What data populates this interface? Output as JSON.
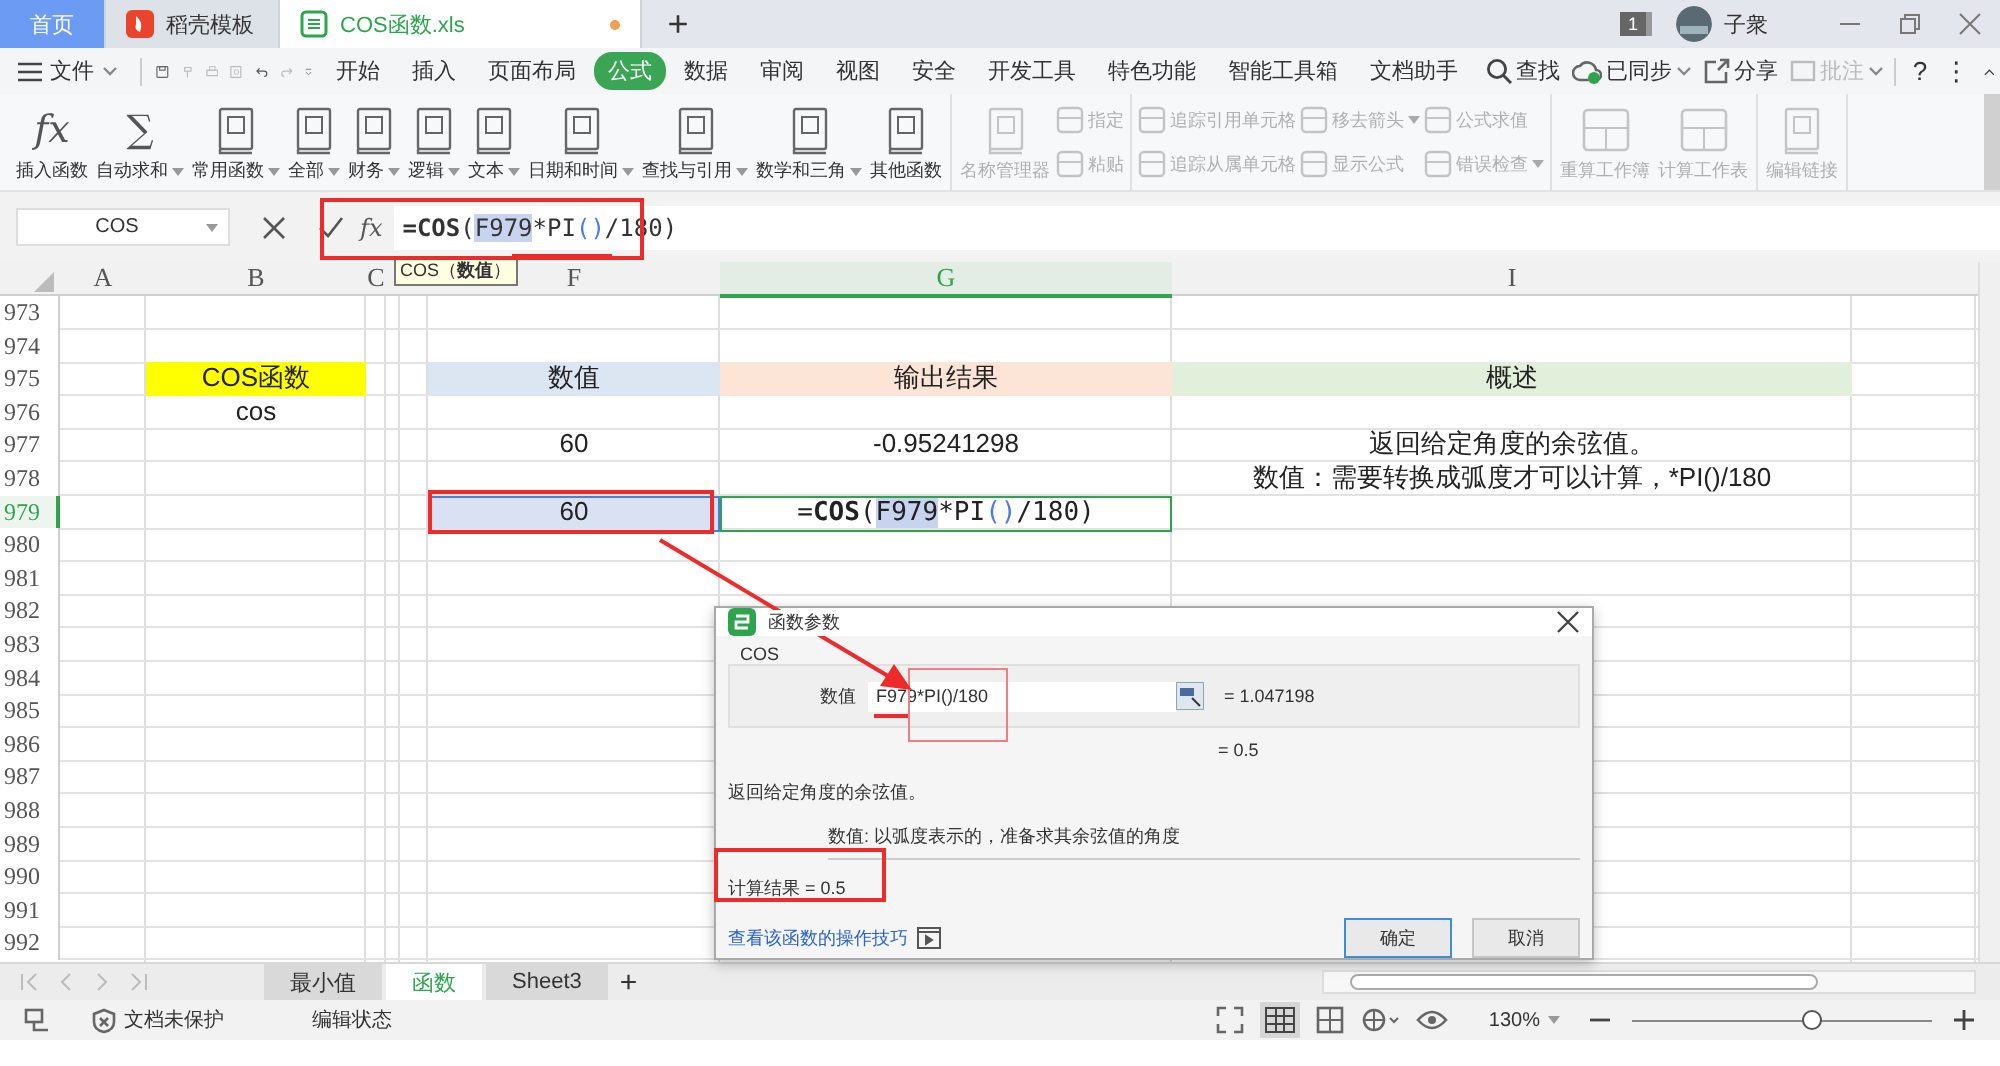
{
  "title_bar": {
    "tabs": [
      {
        "label": "首页",
        "kind": "home",
        "selected": false,
        "unsaved": false
      },
      {
        "label": "稻壳模板",
        "kind": "docer",
        "selected": false,
        "unsaved": false
      },
      {
        "label": "COS函数.xls",
        "kind": "sheet",
        "selected": true,
        "unsaved": true
      }
    ],
    "new_tab": "+",
    "badge": "1",
    "user": "子衆"
  },
  "menu": {
    "file": "文件",
    "tabs": [
      {
        "label": "开始",
        "selected": false
      },
      {
        "label": "插入",
        "selected": false
      },
      {
        "label": "页面布局",
        "selected": false
      },
      {
        "label": "公式",
        "selected": true
      },
      {
        "label": "数据",
        "selected": false
      },
      {
        "label": "审阅",
        "selected": false
      },
      {
        "label": "视图",
        "selected": false
      },
      {
        "label": "安全",
        "selected": false
      },
      {
        "label": "开发工具",
        "selected": false
      },
      {
        "label": "特色功能",
        "selected": false
      },
      {
        "label": "智能工具箱",
        "selected": false
      },
      {
        "label": "文档助手",
        "selected": false
      }
    ],
    "search": "查找",
    "tools": [
      {
        "label": "已同步",
        "kind": "cloud",
        "dropdown": true,
        "disabled": false
      },
      {
        "label": "分享",
        "kind": "share",
        "dropdown": false,
        "disabled": false
      },
      {
        "label": "批注",
        "kind": "comment",
        "dropdown": true,
        "disabled": true
      }
    ],
    "extras": [
      "?",
      "⋮"
    ]
  },
  "ribbon": {
    "groups": [
      {
        "items": [
          {
            "kind": "glyph",
            "glyph": "fx",
            "label": "插入函数",
            "dropdown": false,
            "disabled": false
          },
          {
            "kind": "glyph",
            "glyph": "∑",
            "label": "自动求和",
            "dropdown": true,
            "disabled": false
          },
          {
            "kind": "book",
            "label": "常用函数",
            "dropdown": true,
            "disabled": false
          },
          {
            "kind": "book",
            "label": "全部",
            "dropdown": true,
            "disabled": false
          },
          {
            "kind": "book",
            "label": "财务",
            "dropdown": true,
            "disabled": false
          },
          {
            "kind": "book",
            "label": "逻辑",
            "dropdown": true,
            "disabled": false
          },
          {
            "kind": "book",
            "label": "文本",
            "dropdown": true,
            "disabled": false
          },
          {
            "kind": "book",
            "label": "日期和时间",
            "dropdown": true,
            "disabled": false
          },
          {
            "kind": "book",
            "label": "查找与引用",
            "dropdown": true,
            "disabled": false
          },
          {
            "kind": "book",
            "label": "数学和三角",
            "dropdown": true,
            "disabled": false
          },
          {
            "kind": "book",
            "label": "其他函数",
            "dropdown": false,
            "disabled": false
          }
        ]
      },
      {
        "items": [
          {
            "kind": "book",
            "label": "名称管理器",
            "dropdown": false,
            "disabled": true
          },
          {
            "kind": "stack",
            "items": [
              {
                "label": "指定",
                "dropdown": false,
                "disabled": true
              },
              {
                "label": "粘贴",
                "dropdown": false,
                "disabled": true
              }
            ]
          }
        ]
      },
      {
        "items": [
          {
            "kind": "stack",
            "items": [
              {
                "label": "追踪引用单元格",
                "dropdown": false,
                "disabled": true
              },
              {
                "label": "追踪从属单元格",
                "dropdown": false,
                "disabled": true
              }
            ]
          },
          {
            "kind": "stack",
            "items": [
              {
                "label": "移去箭头",
                "dropdown": true,
                "disabled": true
              },
              {
                "label": "显示公式",
                "dropdown": false,
                "disabled": true
              }
            ]
          },
          {
            "kind": "stack",
            "items": [
              {
                "label": "公式求值",
                "dropdown": false,
                "disabled": true
              },
              {
                "label": "错误检查",
                "dropdown": true,
                "disabled": true
              }
            ]
          }
        ]
      },
      {
        "items": [
          {
            "kind": "table",
            "label": "重算工作簿",
            "dropdown": false,
            "disabled": true
          },
          {
            "kind": "table",
            "label": "计算工作表",
            "dropdown": false,
            "disabled": true
          }
        ]
      },
      {
        "items": [
          {
            "kind": "book",
            "label": "编辑链接",
            "dropdown": false,
            "disabled": true
          }
        ]
      }
    ]
  },
  "formula_bar": {
    "name_box": "COS",
    "fx": "fx",
    "formula": [
      {
        "text": "=",
        "kind": "func"
      },
      {
        "text": "COS",
        "kind": "func"
      },
      {
        "text": "(",
        "kind": "text"
      },
      {
        "text": "F979",
        "kind": "ref"
      },
      {
        "text": "*PI",
        "kind": "text"
      },
      {
        "text": "()",
        "kind": "paren"
      },
      {
        "text": "/180)",
        "kind": "text"
      }
    ],
    "tooltip": "COS（**数值**）"
  },
  "sheet": {
    "columns": [
      {
        "label": "A",
        "selected": false
      },
      {
        "label": "B",
        "selected": false
      },
      {
        "label": "C",
        "selected": false
      },
      {
        "selected": false
      },
      {
        "selected": false
      },
      {
        "label": "F",
        "selected": false
      },
      {
        "label": "G",
        "selected": true
      },
      {
        "label": "I",
        "selected": false
      },
      {
        "selected": false
      }
    ],
    "rows": [
      {
        "number": "973",
        "selected": false
      },
      {
        "number": "974",
        "selected": false
      },
      {
        "number": "975",
        "selected": false,
        "cells": [
          null,
          {
            "text": "COS函数",
            "color": "#ffff00"
          },
          null,
          null,
          null,
          {
            "text": "数值",
            "color": "#dce6f2"
          },
          {
            "text": "输出结果",
            "color": "#fce4d6"
          },
          {
            "text": "概述",
            "color": "#e2efda"
          },
          null
        ]
      },
      {
        "number": "976",
        "selected": false,
        "cells": [
          null,
          {
            "text": "cos"
          },
          null,
          null,
          null,
          null,
          null,
          null,
          null
        ]
      },
      {
        "number": "977",
        "selected": false,
        "cells": [
          null,
          null,
          null,
          null,
          null,
          {
            "text": "60"
          },
          {
            "text": "-0.95241298"
          },
          {
            "text": "返回给定角度的余弦值。"
          },
          null
        ]
      },
      {
        "number": "978",
        "selected": false,
        "cells": [
          null,
          null,
          null,
          null,
          null,
          null,
          null,
          {
            "text": "数值：需要转换成弧度才可以计算，*PI()/180"
          },
          null
        ]
      },
      {
        "number": "979",
        "selected": true,
        "cells": [
          null,
          null,
          null,
          null,
          null,
          {
            "text": "60",
            "selected": true,
            "color": "#d9e1f2"
          },
          {
            "formula": [
              {
                "text": "=",
                "kind": "text"
              },
              {
                "text": "COS",
                "kind": "func"
              },
              {
                "text": "(",
                "kind": "text"
              },
              {
                "text": "F979",
                "kind": "ref"
              },
              {
                "text": "*PI",
                "kind": "text"
              },
              {
                "text": "()",
                "kind": "paren"
              },
              {
                "text": "/180)",
                "kind": "text"
              }
            ]
          },
          null,
          null
        ]
      },
      {
        "number": "980",
        "selected": false
      },
      {
        "number": "981",
        "selected": false
      },
      {
        "number": "982",
        "selected": false
      },
      {
        "number": "983",
        "selected": false
      },
      {
        "number": "984",
        "selected": false
      },
      {
        "number": "985",
        "selected": false
      },
      {
        "number": "986",
        "selected": false
      },
      {
        "number": "987",
        "selected": false
      },
      {
        "number": "988",
        "selected": false
      },
      {
        "number": "989",
        "selected": false
      },
      {
        "number": "990",
        "selected": false
      },
      {
        "number": "991",
        "selected": false
      },
      {
        "number": "992",
        "selected": false
      }
    ]
  },
  "dialog": {
    "title": "函数参数",
    "function": "COS",
    "argument": {
      "label": "数值",
      "value": "F979*PI()/180",
      "result": "= 1.047198"
    },
    "result": "= 0.5",
    "description": "返回给定角度的余弦值。",
    "argument_help": "数值:  以弧度表示的，准备求其余弦值的角度",
    "calculation": "计算结果  =  0.5",
    "help_link": "查看该函数的操作技巧",
    "buttons": [
      {
        "label": "确定",
        "primary": true
      },
      {
        "label": "取消",
        "primary": false
      }
    ]
  },
  "sheet_tabs": {
    "tabs": [
      {
        "label": "最小值",
        "selected": false
      },
      {
        "label": "函数",
        "selected": true
      },
      {
        "label": "Sheet3",
        "selected": false
      }
    ],
    "add": "+"
  },
  "status_bar": {
    "protection": "文档未保护",
    "mode": "编辑状态",
    "zoom": "130%",
    "zoom_slider": {
      "level": 0.6
    }
  }
}
